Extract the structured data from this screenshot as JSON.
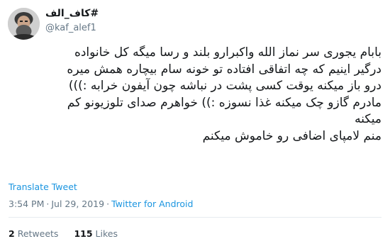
{
  "author": {
    "display_name": "#کاف_الف",
    "handle": "@kaf_alef1"
  },
  "tweet": {
    "lines": [
      "بابام یجوری سر نماز الله واکبرارو بلند و رسا میگه کل خانواده",
      "درگیر اینیم که چه اتفاقی افتاده تو خونه سام بیچاره همش میره",
      "درو باز میکنه یوقت کسی پشت در نباشه چون آیفون خرابه :)))",
      "مادرم گازو چک میکنه غذا نسوزه :)) خواهرم صدای تلوزیونو کم",
      "میکنه",
      "منم لامپای اضافی رو خاموش میکنم"
    ]
  },
  "translate_label": "Translate Tweet",
  "meta": {
    "time": "3:54 PM",
    "separator": "·",
    "date": "Jul 29, 2019",
    "client": "Twitter for Android"
  },
  "stats": {
    "retweets_count": "2",
    "retweets_label": "Retweets",
    "likes_count": "115",
    "likes_label": "Likes"
  },
  "colors": {
    "link": "#1b95e0",
    "muted": "#657786",
    "text": "#14171a"
  },
  "icons": {
    "avatar": "profile-photo"
  }
}
